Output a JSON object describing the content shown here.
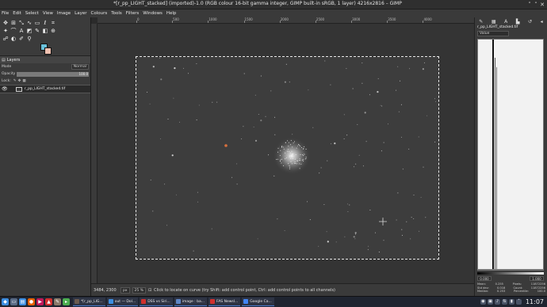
{
  "window": {
    "title": "*[r_pp_LIGHT_stacked] (imported)-1.0 (RGB colour 16-bit gamma integer, GIMP built-in sRGB, 1 layer) 4216x2816 – GIMP"
  },
  "menu": [
    "File",
    "Edit",
    "Select",
    "View",
    "Image",
    "Layer",
    "Colours",
    "Tools",
    "Filters",
    "Windows",
    "Help"
  ],
  "colors": {
    "foreground": "#6ac0d9",
    "background": "#f0c0b0"
  },
  "layers_panel": {
    "tab": "Layers",
    "mode_label": "Mode",
    "mode_value": "Normal",
    "opacity_label": "Opacity",
    "opacity_value": "100.0",
    "opacity_fraction": 1.0,
    "lock_label": "Lock:",
    "layer_name": "r_pp_LIGHT_stacked.tif"
  },
  "ruler": [
    "0",
    "500",
    "1000",
    "1500",
    "2000",
    "2500",
    "3000",
    "3500",
    "4000"
  ],
  "status": {
    "coords": "3484, 2300",
    "unit": "px",
    "zoom": "25 %",
    "message": "Click to locate on curve (try Shift: add control point, Ctrl: add control points to all channels)"
  },
  "histogram_panel": {
    "title": "r_pp_LIGHT_stacked.tif",
    "channel": "Value",
    "range_min": "0.000",
    "range_max": "1.000",
    "stats": [
      [
        "Mean:",
        "0.255",
        "Pixels:",
        "11872256"
      ],
      [
        "Std dev:",
        "0.018",
        "Count:",
        "11872256"
      ],
      [
        "Median:",
        "0.253",
        "Percentile:",
        "100.0"
      ]
    ]
  },
  "taskbar": {
    "tasks": [
      {
        "label": "*[r_pp_LIG...",
        "color": "#6b5a4e"
      },
      {
        "label": "out — Dol...",
        "color": "#3d8ee0"
      },
      {
        "label": "DSS vs Siri...",
        "color": "#d0302e"
      },
      {
        "label": "image : ba...",
        "color": "#5f86c4"
      },
      {
        "label": "FAS Newsl...",
        "color": "#d0302e"
      },
      {
        "label": "Google Ca...",
        "color": "#4285f4"
      }
    ],
    "clock": "11:07"
  }
}
